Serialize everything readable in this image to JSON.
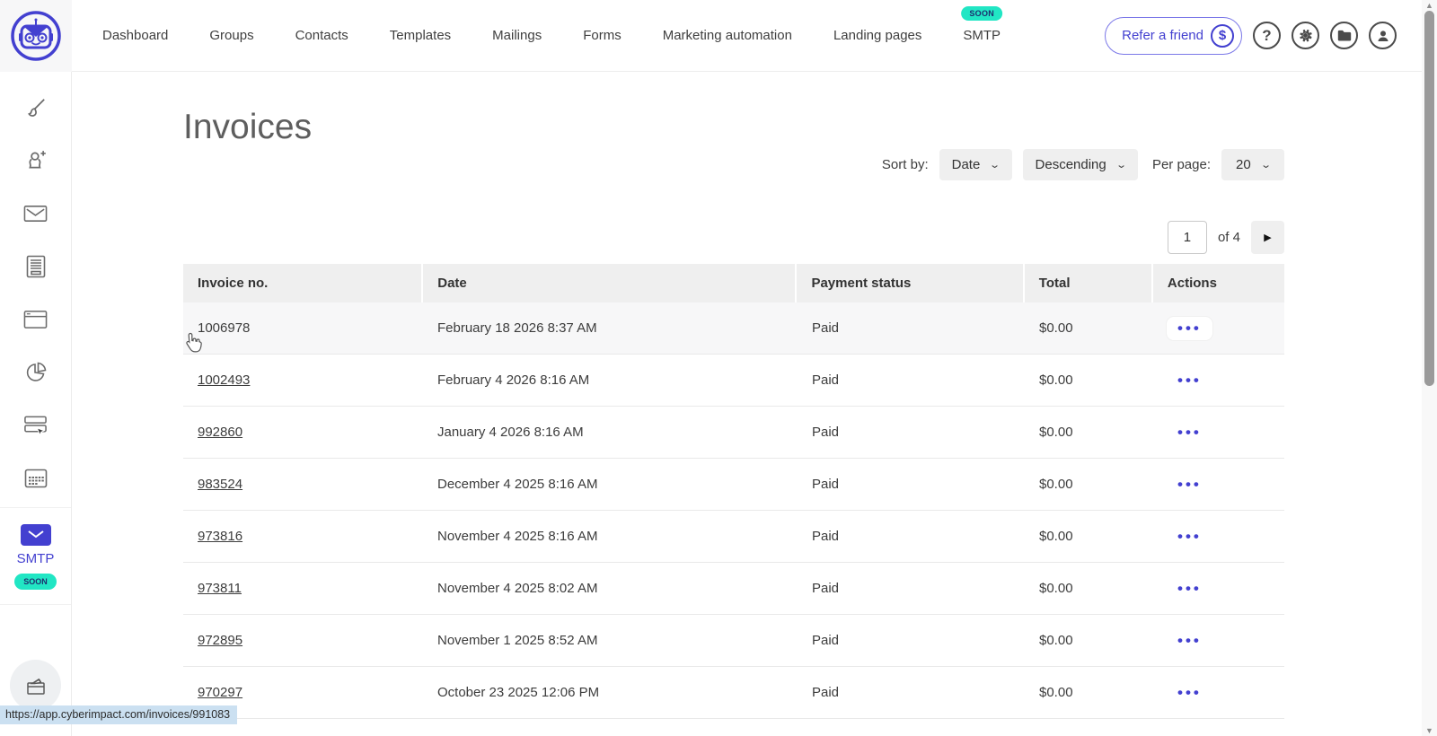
{
  "colors": {
    "accent": "#4340d0",
    "teal": "#21e6c4",
    "table_header_bg": "#efefef",
    "row_hover_bg": "#f7f7f8",
    "statusbar_bg": "#cbe0f1"
  },
  "topnav": {
    "items": [
      {
        "label": "Dashboard",
        "badge": null
      },
      {
        "label": "Groups",
        "badge": null
      },
      {
        "label": "Contacts",
        "badge": null
      },
      {
        "label": "Templates",
        "badge": null
      },
      {
        "label": "Mailings",
        "badge": null
      },
      {
        "label": "Forms",
        "badge": null
      },
      {
        "label": "Marketing automation",
        "badge": null
      },
      {
        "label": "Landing pages",
        "badge": null
      },
      {
        "label": "SMTP",
        "badge": "SOON"
      }
    ],
    "refer_button_label": "Refer a friend",
    "dollar_symbol": "$",
    "help_symbol": "?"
  },
  "sidebar": {
    "icons": [
      {
        "name": "paintbrush-icon"
      },
      {
        "name": "add-contact-icon"
      },
      {
        "name": "envelope-icon"
      },
      {
        "name": "document-icon"
      },
      {
        "name": "browser-window-icon"
      },
      {
        "name": "pie-chart-icon"
      },
      {
        "name": "banner-select-icon"
      },
      {
        "name": "calendar-grid-icon"
      }
    ],
    "smtp_label": "SMTP",
    "smtp_badge": "SOON"
  },
  "page": {
    "title": "Invoices"
  },
  "controls": {
    "sort_by_label": "Sort by:",
    "sort_field_value": "Date",
    "sort_direction_value": "Descending",
    "per_page_label": "Per page:",
    "per_page_value": "20",
    "chevron": "⌄"
  },
  "pagination": {
    "current_page": "1",
    "of_label": "of 4",
    "next_symbol": "▶"
  },
  "table": {
    "columns": [
      "Invoice no.",
      "Date",
      "Payment status",
      "Total",
      "Actions"
    ],
    "actions_symbol": "•••",
    "rows": [
      {
        "invoice": "1006978",
        "date": "February 18 2026 8:37 AM",
        "status": "Paid",
        "total": "$0.00",
        "hovered": true
      },
      {
        "invoice": "1002493",
        "date": "February 4 2026 8:16 AM",
        "status": "Paid",
        "total": "$0.00",
        "hovered": false
      },
      {
        "invoice": "992860",
        "date": "January 4 2026 8:16 AM",
        "status": "Paid",
        "total": "$0.00",
        "hovered": false
      },
      {
        "invoice": "983524",
        "date": "December 4 2025 8:16 AM",
        "status": "Paid",
        "total": "$0.00",
        "hovered": false
      },
      {
        "invoice": "973816",
        "date": "November 4 2025 8:16 AM",
        "status": "Paid",
        "total": "$0.00",
        "hovered": false
      },
      {
        "invoice": "973811",
        "date": "November 4 2025 8:02 AM",
        "status": "Paid",
        "total": "$0.00",
        "hovered": false
      },
      {
        "invoice": "972895",
        "date": "November 1 2025 8:52 AM",
        "status": "Paid",
        "total": "$0.00",
        "hovered": false
      },
      {
        "invoice": "970297",
        "date": "October 23 2025 12:06 PM",
        "status": "Paid",
        "total": "$0.00",
        "hovered": false
      }
    ]
  },
  "statusbar": {
    "url": "https://app.cyberimpact.com/invoices/991083"
  }
}
